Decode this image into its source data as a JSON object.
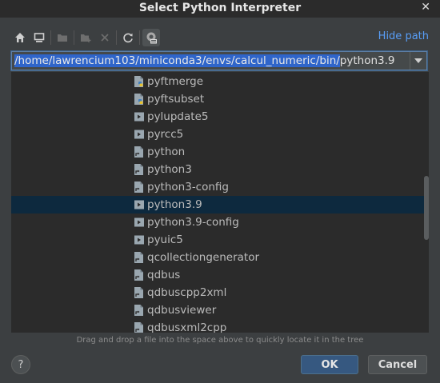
{
  "dialog": {
    "title": "Select Python Interpreter",
    "close_symbol": "✕"
  },
  "toolbar": {
    "buttons": [
      {
        "icon": "home-icon"
      },
      {
        "icon": "desktop-icon"
      },
      {
        "icon": "project-folder-icon"
      },
      {
        "icon": "new-folder-icon"
      },
      {
        "icon": "delete-icon"
      },
      {
        "icon": "refresh-icon"
      },
      {
        "icon": "show-hidden-files-icon"
      }
    ],
    "hide_path_label": "Hide path"
  },
  "path_field": {
    "selected_part": "/home/lawrencium103/miniconda3/envs/calcul_numeric/bin/",
    "unselected_part": "python3.9"
  },
  "tree": {
    "items": [
      {
        "name": "pyftmerge",
        "icon": "python-script-icon",
        "selected": false
      },
      {
        "name": "pyftsubset",
        "icon": "python-script-icon",
        "selected": false
      },
      {
        "name": "pylupdate5",
        "icon": "executable-icon",
        "selected": false
      },
      {
        "name": "pyrcc5",
        "icon": "executable-icon",
        "selected": false
      },
      {
        "name": "python",
        "icon": "symlink-icon",
        "selected": false
      },
      {
        "name": "python3",
        "icon": "symlink-icon",
        "selected": false
      },
      {
        "name": "python3-config",
        "icon": "symlink-icon",
        "selected": false
      },
      {
        "name": "python3.9",
        "icon": "executable-icon",
        "selected": true
      },
      {
        "name": "python3.9-config",
        "icon": "executable-icon",
        "selected": false
      },
      {
        "name": "pyuic5",
        "icon": "executable-icon",
        "selected": false
      },
      {
        "name": "qcollectiongenerator",
        "icon": "symlink-icon",
        "selected": false
      },
      {
        "name": "qdbus",
        "icon": "symlink-icon",
        "selected": false
      },
      {
        "name": "qdbuscpp2xml",
        "icon": "symlink-icon",
        "selected": false
      },
      {
        "name": "qdbusviewer",
        "icon": "symlink-icon",
        "selected": false
      },
      {
        "name": "qdbusxml2cpp",
        "icon": "symlink-icon",
        "selected": false
      }
    ]
  },
  "hint": "Drag and drop a file into the space above to quickly locate it in the tree",
  "buttons": {
    "help": "?",
    "ok": "OK",
    "cancel": "Cancel"
  },
  "colors": {
    "background": "#3c3f41",
    "tree_background": "#2b2b2b",
    "selection": "#0d293e",
    "path_selection": "#2f65ca",
    "link": "#589df6",
    "ok_button": "#365880"
  }
}
